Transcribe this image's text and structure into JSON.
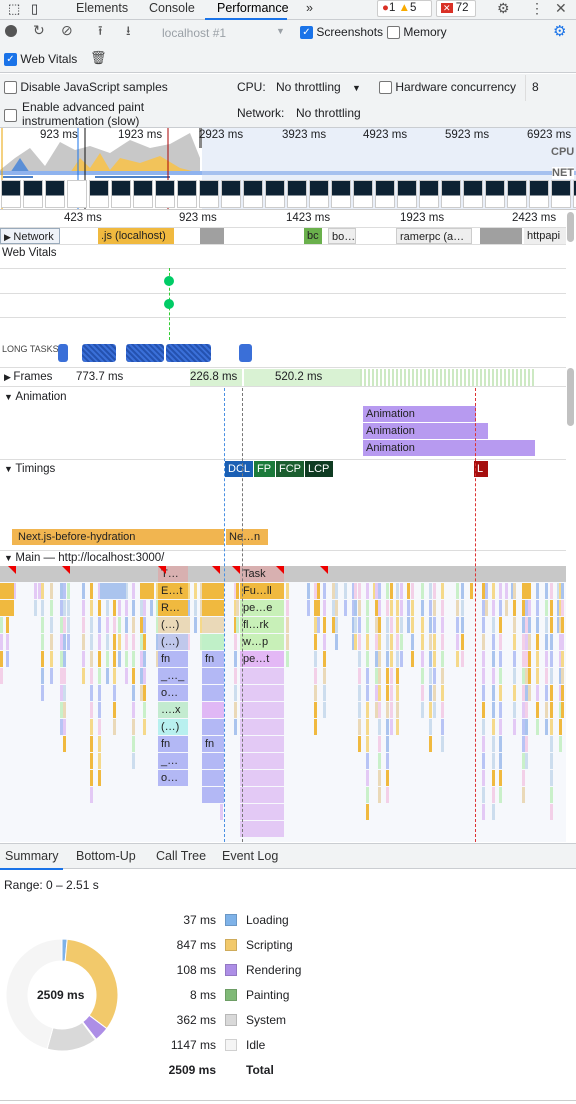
{
  "tabs": {
    "items": [
      "Elements",
      "Console",
      "Performance"
    ],
    "active": "Performance",
    "more": "»"
  },
  "badges": {
    "errors": "1",
    "warnings": "5",
    "issues": "72"
  },
  "toolbar": {
    "target": "localhost #1",
    "screenshots_label": "Screenshots",
    "screenshots_checked": true,
    "memory_label": "Memory",
    "memory_checked": false,
    "web_vitals_label": "Web Vitals",
    "web_vitals_checked": true
  },
  "settings": {
    "disable_js": "Disable JavaScript samples",
    "adv_paint_1": "Enable advanced paint",
    "adv_paint_2": "instrumentation (slow)",
    "cpu_label": "CPU:",
    "cpu_value": "No throttling",
    "network_label": "Network:",
    "network_value": "No throttling",
    "hw_label": "Hardware concurrency",
    "hw_value": "8"
  },
  "overview": {
    "ticks": [
      "923 ms",
      "1923 ms",
      "2923 ms",
      "3923 ms",
      "4923 ms",
      "5923 ms",
      "6923 ms"
    ],
    "cpu": "CPU",
    "net": "NET"
  },
  "ruler": {
    "ticks": [
      "423 ms",
      "923 ms",
      "1423 ms",
      "1923 ms",
      "2423 ms"
    ]
  },
  "tracks": {
    "network": {
      "label": "Network",
      "items": [
        ".js (localhost)",
        "bc",
        "bo…",
        "ramerpc (a…",
        "httpapi"
      ]
    },
    "web_vitals": "Web Vitals",
    "long_tasks": "LONG TASKS",
    "frames": {
      "label": "Frames",
      "values": [
        "773.7 ms",
        "226.8 ms",
        "520.2 ms"
      ]
    },
    "animation": {
      "label": "Animation",
      "items": [
        "Animation",
        "Animation",
        "Animation"
      ]
    },
    "timings": {
      "label": "Timings",
      "markers": [
        "DCL",
        "FP",
        "FCP",
        "LCP",
        "L"
      ],
      "bars": [
        "Next.js-before-hydration",
        "Ne…n"
      ]
    },
    "main": {
      "label": "Main — http://localhost:3000/",
      "col1": [
        "T…",
        "E…t",
        "R…",
        "(…)",
        "(…)",
        "fn",
        "_…_",
        "o…",
        "….x",
        "(…)",
        "fn",
        "_…",
        "o…"
      ],
      "col2": [
        "fn",
        "fn"
      ],
      "col3": [
        "Task",
        "Fu…ll",
        "pe…e",
        "fl…rk",
        "w…p",
        "pe…t"
      ]
    }
  },
  "bottom_tabs": {
    "items": [
      "Summary",
      "Bottom-Up",
      "Call Tree",
      "Event Log"
    ],
    "active": "Summary"
  },
  "summary": {
    "range": "Range: 0 – 2.51 s",
    "total_center": "2509 ms",
    "rows": [
      {
        "value": "37 ms",
        "label": "Loading",
        "color": "#7eb2e8",
        "ms": 37
      },
      {
        "value": "847 ms",
        "label": "Scripting",
        "color": "#f2c96b",
        "ms": 847
      },
      {
        "value": "108 ms",
        "label": "Rendering",
        "color": "#ad8ee6",
        "ms": 108
      },
      {
        "value": "8 ms",
        "label": "Painting",
        "color": "#80b977",
        "ms": 8
      },
      {
        "value": "362 ms",
        "label": "System",
        "color": "#d9d9d9",
        "ms": 362
      },
      {
        "value": "1147 ms",
        "label": "Idle",
        "color": "#f5f5f5",
        "ms": 1147
      }
    ],
    "total_value": "2509 ms",
    "total_label": "Total"
  }
}
